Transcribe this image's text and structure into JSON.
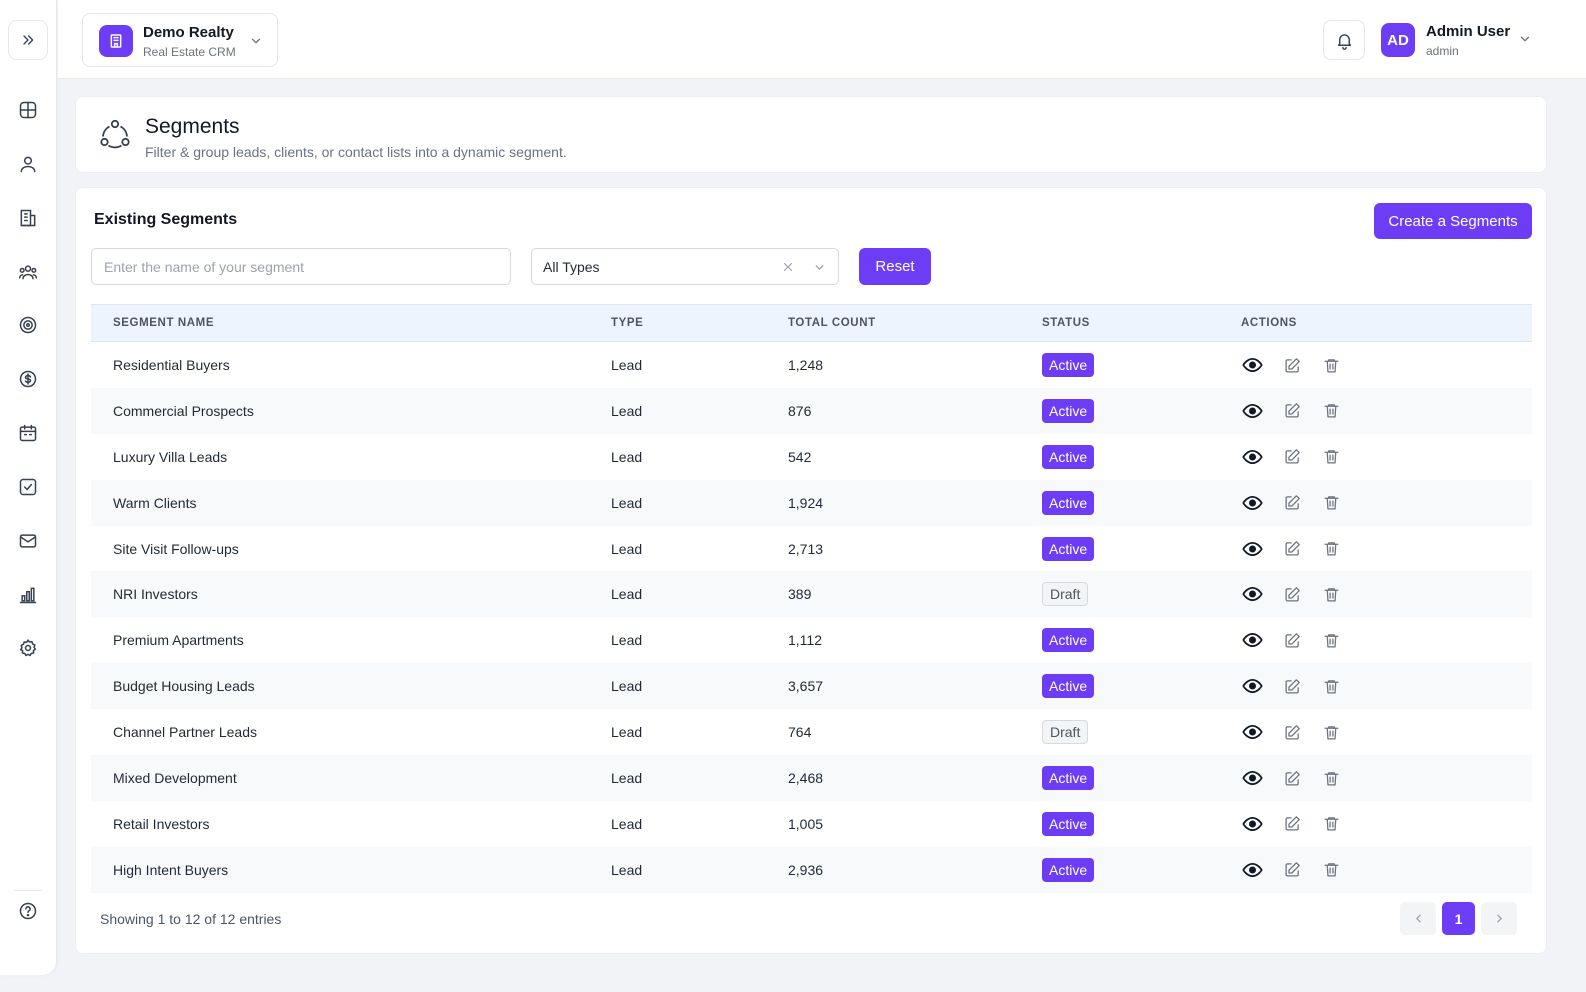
{
  "org": {
    "name": "Demo Realty",
    "subtitle": "Real Estate CRM"
  },
  "user": {
    "initials": "AD",
    "name": "Admin User",
    "role": "admin"
  },
  "page": {
    "title": "Segments",
    "subtitle": "Filter & group leads, clients, or contact lists into a dynamic segment."
  },
  "card": {
    "title": "Existing Segments",
    "create_label": "Create a Segments",
    "search_placeholder": "Enter the name of your segment",
    "type_filter": "All Types",
    "reset_label": "Reset"
  },
  "table": {
    "headers": {
      "name": "SEGMENT NAME",
      "type": "TYPE",
      "count": "TOTAL COUNT",
      "status": "STATUS",
      "actions": "ACTIONS"
    },
    "rows": [
      {
        "name": "Residential Buyers",
        "type": "Lead",
        "count": "1,248",
        "status": "Active"
      },
      {
        "name": "Commercial Prospects",
        "type": "Lead",
        "count": "876",
        "status": "Active"
      },
      {
        "name": "Luxury Villa Leads",
        "type": "Lead",
        "count": "542",
        "status": "Active"
      },
      {
        "name": "Warm Clients",
        "type": "Lead",
        "count": "1,924",
        "status": "Active"
      },
      {
        "name": "Site Visit Follow-ups",
        "type": "Lead",
        "count": "2,713",
        "status": "Active"
      },
      {
        "name": "NRI Investors",
        "type": "Lead",
        "count": "389",
        "status": "Draft"
      },
      {
        "name": "Premium Apartments",
        "type": "Lead",
        "count": "1,112",
        "status": "Active"
      },
      {
        "name": "Budget Housing Leads",
        "type": "Lead",
        "count": "3,657",
        "status": "Active"
      },
      {
        "name": "Channel Partner Leads",
        "type": "Lead",
        "count": "764",
        "status": "Draft"
      },
      {
        "name": "Mixed Development",
        "type": "Lead",
        "count": "2,468",
        "status": "Active"
      },
      {
        "name": "Retail Investors",
        "type": "Lead",
        "count": "1,005",
        "status": "Active"
      },
      {
        "name": "High Intent Buyers",
        "type": "Lead",
        "count": "2,936",
        "status": "Active"
      }
    ]
  },
  "footer": {
    "entries": "Showing 1 to 12 of 12 entries",
    "current_page": "1"
  },
  "sidebar": {
    "icons": [
      "dashboard-icon",
      "user-icon",
      "building-icon",
      "users-icon",
      "target-icon",
      "dollar-icon",
      "calendar-icon",
      "task-check-icon",
      "mail-icon",
      "bar-chart-icon",
      "gear-icon",
      "help-icon"
    ]
  },
  "colors": {
    "accent": "#6d3df5",
    "header_bg": "#eef4fd",
    "page_bg": "#f1f3f7"
  }
}
